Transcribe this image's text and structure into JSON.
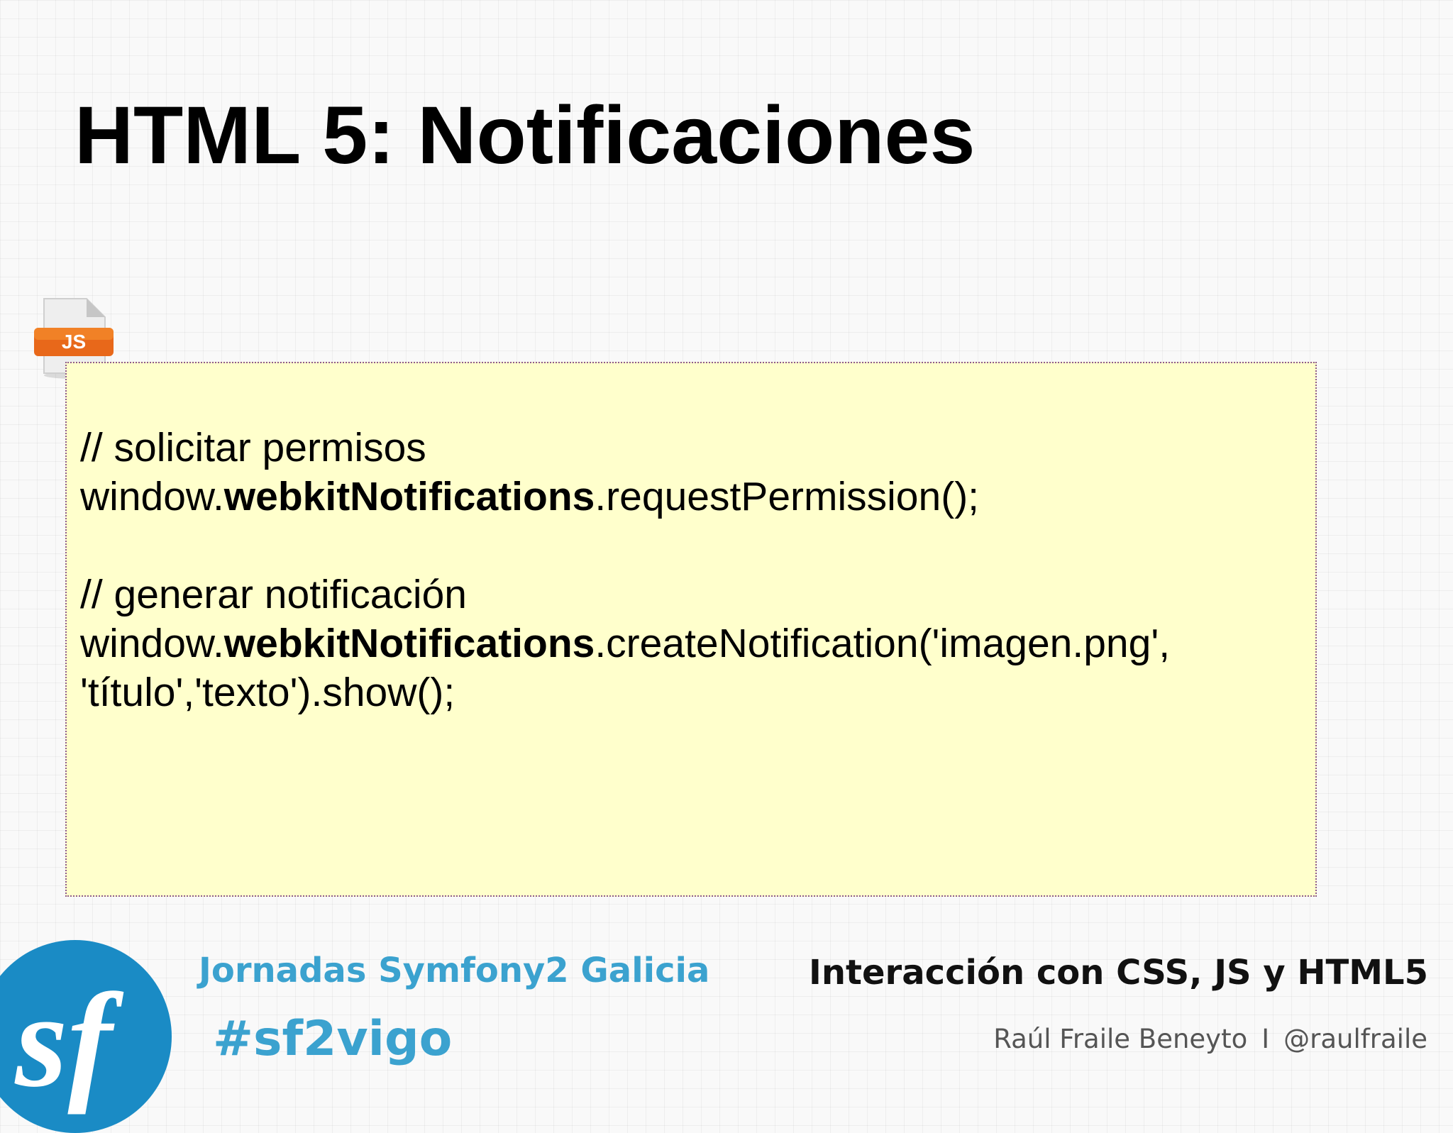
{
  "slide": {
    "title": "HTML 5: Notificaciones"
  },
  "code_icon": {
    "icon": "js-file-icon",
    "badge": "JS",
    "badge_color": "#e8681a"
  },
  "code": {
    "comment1": "// solicitar permisos",
    "line1_prefix": "window.",
    "line1_bold": "webkitNotifications",
    "line1_suffix": ".requestPermission();",
    "comment2": "// generar notificación",
    "line2_prefix": "window.",
    "line2_bold": "webkitNotifications",
    "line2_suffix": ".createNotification('imagen.png',",
    "line3": "'título','texto').show();",
    "background_color": "#ffffcc"
  },
  "footer": {
    "logo_icon": "symfony-logo-icon",
    "logo_color": "#1a8bc5",
    "event_name": "Jornadas Symfony2 Galicia",
    "hashtag": "#sf2vigo",
    "talk_title": "Interacción con CSS, JS y HTML5",
    "author": "Raúl Fraile Beneyto",
    "separator": "I",
    "handle": "@raulfraile",
    "accent_color": "#3ba2cf"
  }
}
